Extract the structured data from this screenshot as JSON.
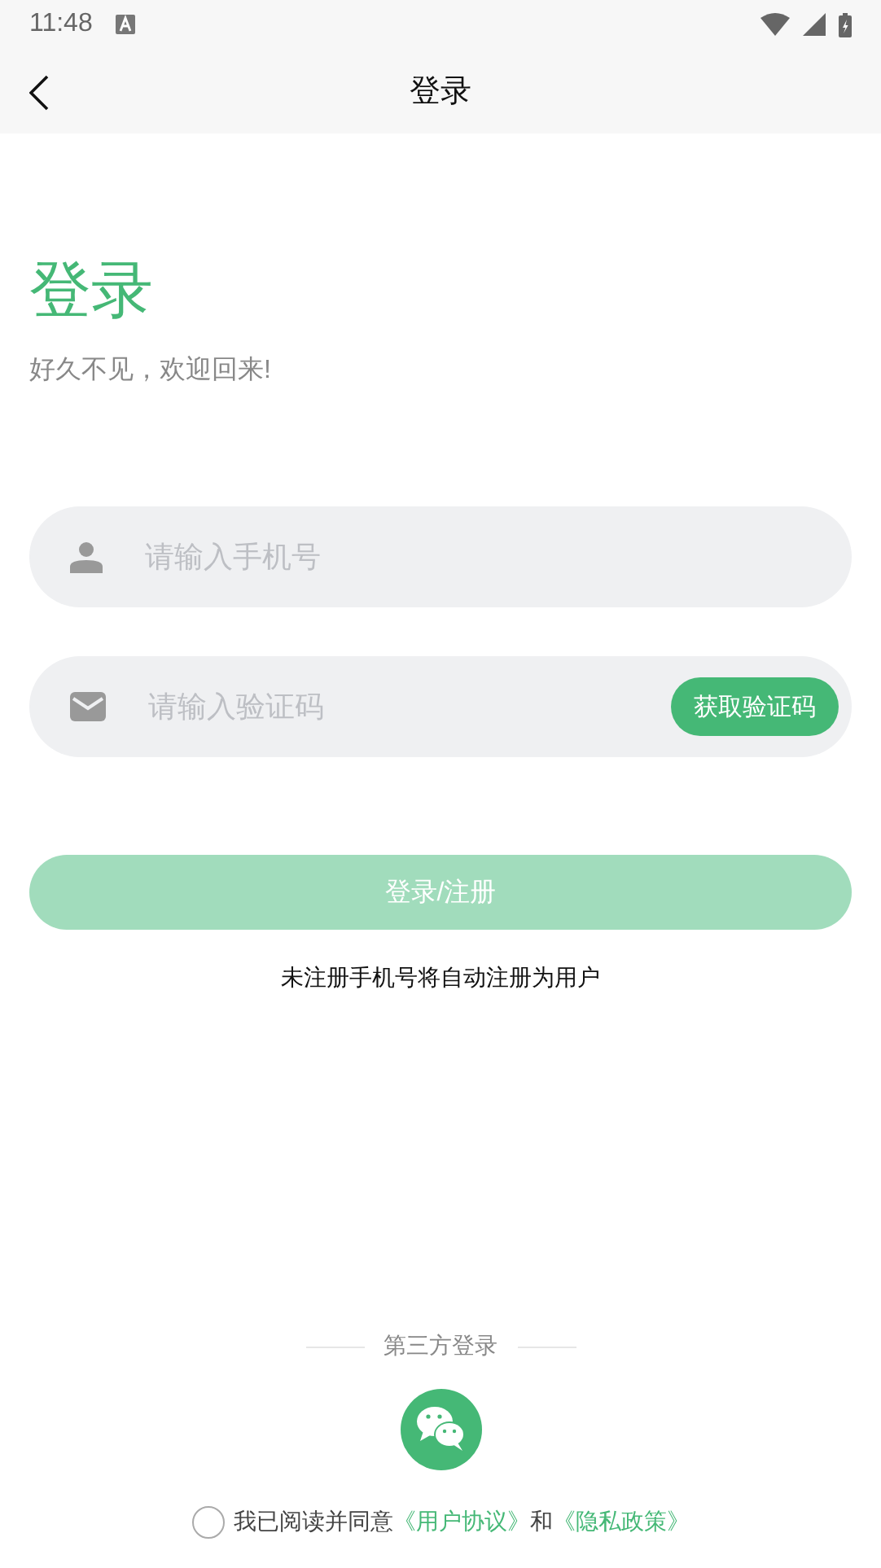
{
  "status_bar": {
    "time": "11:48"
  },
  "header": {
    "title": "登录"
  },
  "heading": "登录",
  "subtitle": "好久不见，欢迎回来!",
  "phone_field": {
    "placeholder": "请输入手机号"
  },
  "code_field": {
    "placeholder": "请输入验证码",
    "button": "获取验证码"
  },
  "login_button": {
    "label": "登录/注册",
    "disabled": true
  },
  "note": "未注册手机号将自动注册为用户",
  "third_party": {
    "label": "第三方登录"
  },
  "agreement": {
    "checked": false,
    "text": "我已阅读并同意",
    "link_1": "《用户协议》",
    "and": "和",
    "link_2": "《隐私政策》"
  }
}
